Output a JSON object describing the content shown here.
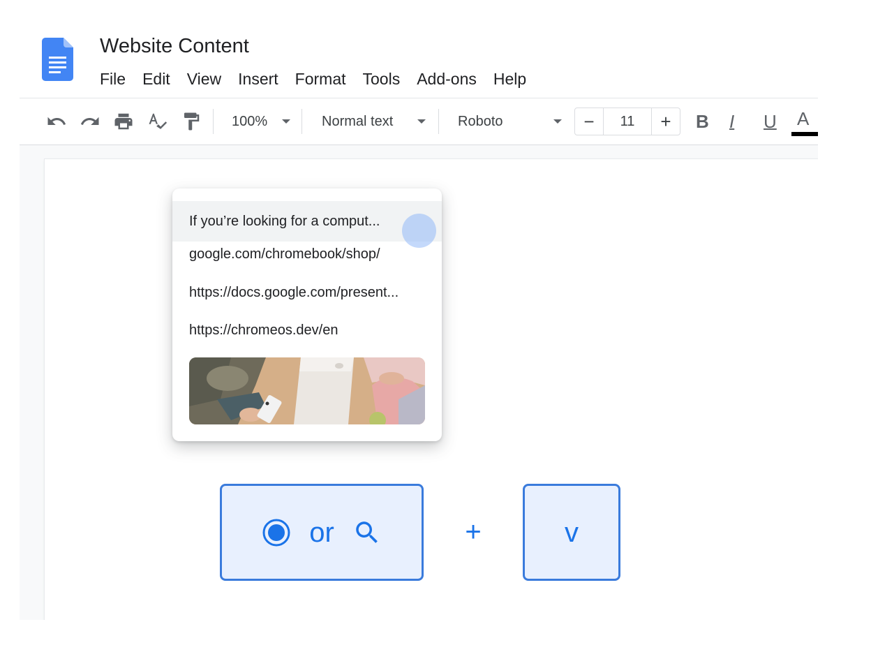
{
  "document": {
    "title": "Website Content"
  },
  "menu": [
    "File",
    "Edit",
    "View",
    "Insert",
    "Format",
    "Tools",
    "Add-ons",
    "Help"
  ],
  "toolbar": {
    "zoom": "100%",
    "style": "Normal text",
    "font": "Roboto",
    "font_size": "11",
    "decrease": "−",
    "increase": "+",
    "bold": "B",
    "italic": "I",
    "underline": "U",
    "text_color": "A",
    "icons": [
      "undo-icon",
      "redo-icon",
      "print-icon",
      "spellcheck-icon",
      "paint-format-icon"
    ]
  },
  "clipboard": {
    "items": [
      "If you’re looking for a comput...",
      "google.com/chromebook/shop/",
      "https://docs.google.com/present...",
      "https://chromeos.dev/en"
    ],
    "highlighted_index": 0
  },
  "shortcut": {
    "or": "or",
    "plus": "+",
    "key": "v"
  },
  "colors": {
    "accent": "#1a73e8",
    "key_fill": "#e8f0fe",
    "doc_icon": "#4285f4"
  }
}
